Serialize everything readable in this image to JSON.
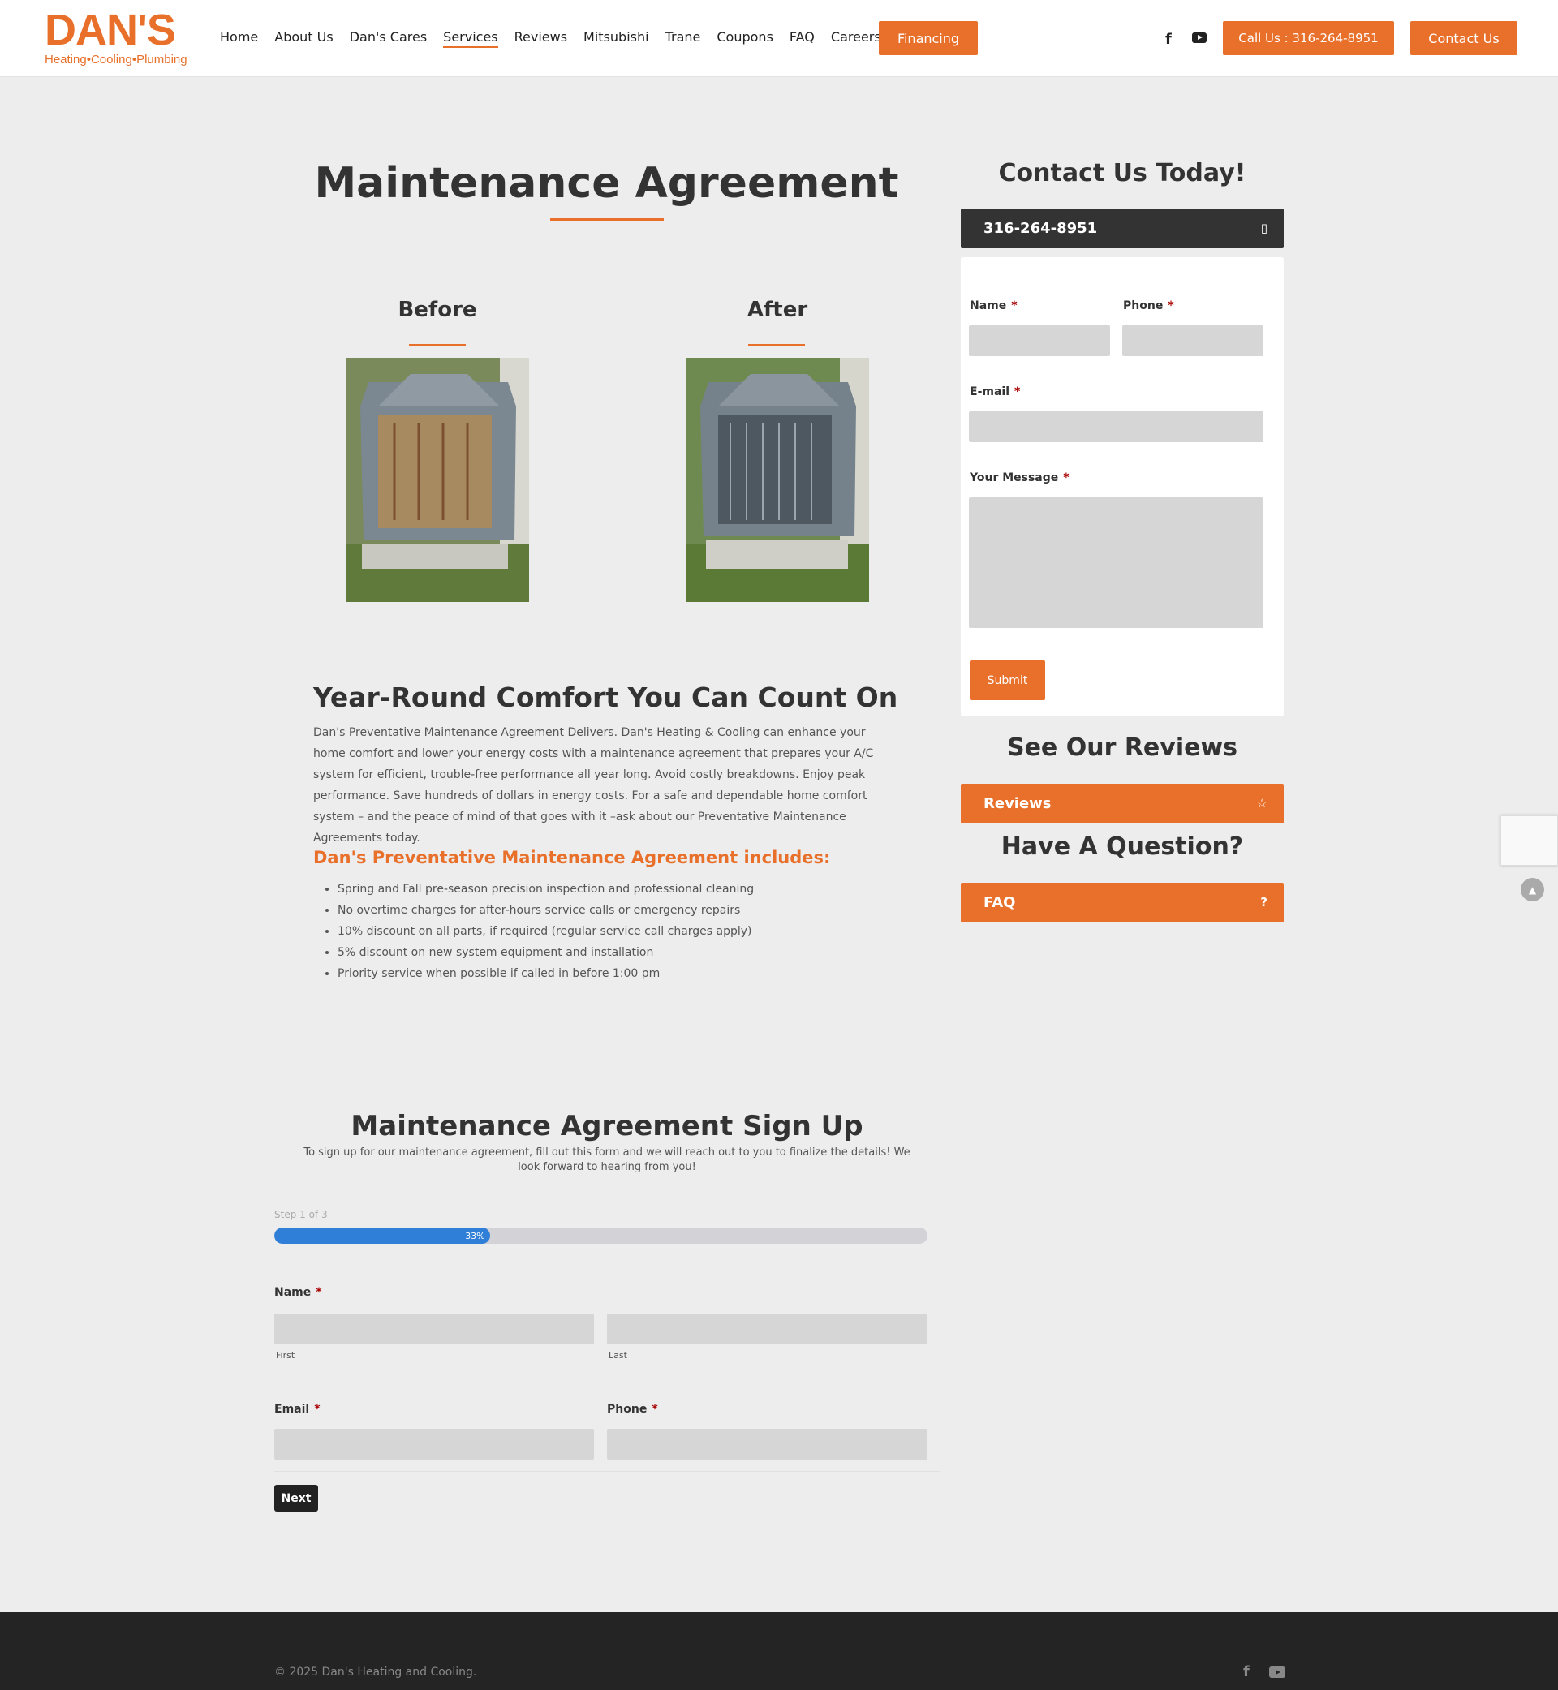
{
  "logo": {
    "name": "DAN'S",
    "tagline": "Heating•Cooling•Plumbing"
  },
  "nav": {
    "items": [
      "Home",
      "About Us",
      "Dan's Cares",
      "Services",
      "Reviews",
      "Mitsubishi",
      "Trane",
      "Coupons",
      "FAQ",
      "Careers"
    ],
    "active": "Services",
    "financing_label": "Financing",
    "call_label": "Call Us : 316-264-8951",
    "contact_label": "Contact Us"
  },
  "main": {
    "title": "Maintenance Agreement",
    "before_label": "Before",
    "after_label": "After",
    "section_title": "Year-Round Comfort You Can Count On",
    "paragraph": "Dan's Preventative Maintenance Agreement Delivers. Dan's Heating & Cooling can enhance your home comfort and lower your energy costs with a maintenance agreement that prepares your A/C system for efficient, trouble-free performance all year long. Avoid costly breakdowns. Enjoy peak performance. Save hundreds of dollars in energy costs. For a safe and dependable home comfort system – and the peace of mind of that goes with it –ask about our Preventative Maintenance Agreements today.",
    "includes_title": "Dan's Preventative Maintenance Agreement includes:",
    "includes": [
      "Spring and Fall pre-season precision inspection and professional cleaning",
      "No overtime charges for after-hours service calls or emergency repairs",
      "10% discount on all parts, if required (regular service call charges apply)",
      "5% discount on new system equipment and installation",
      "Priority service when possible if called in before 1:00 pm"
    ]
  },
  "signup": {
    "title": "Maintenance Agreement Sign Up",
    "description": "To sign up for our maintenance agreement, fill out this form and we will reach out to you to finalize the details! We look forward to hearing from you!",
    "step_text": "Step 1 of 3",
    "progress_percent": 33,
    "progress_label": "33%",
    "name_label": "Name",
    "first_label": "First",
    "last_label": "Last",
    "email_label": "Email",
    "phone_label": "Phone",
    "required_mark": "*",
    "next_label": "Next"
  },
  "sidebar": {
    "contact_title": "Contact Us Today!",
    "phone": "316-264-8951",
    "form": {
      "name_label": "Name",
      "phone_label": "Phone",
      "email_label": "E-mail",
      "message_label": "Your Message",
      "required_mark": "*",
      "submit_label": "Submit"
    },
    "reviews_title": "See Our Reviews",
    "reviews_label": "Reviews",
    "question_title": "Have A Question?",
    "faq_label": "FAQ"
  },
  "footer": {
    "copyright": "© 2025 Dan's Heating and Cooling."
  },
  "colors": {
    "accent": "#e8702a",
    "dark": "#333333",
    "progress": "#2f7ed8",
    "footer": "#242424"
  },
  "icons": [
    "facebook-icon",
    "youtube-icon",
    "mobile-phone-icon",
    "star-icon",
    "question-icon",
    "arrow-up-icon"
  ]
}
